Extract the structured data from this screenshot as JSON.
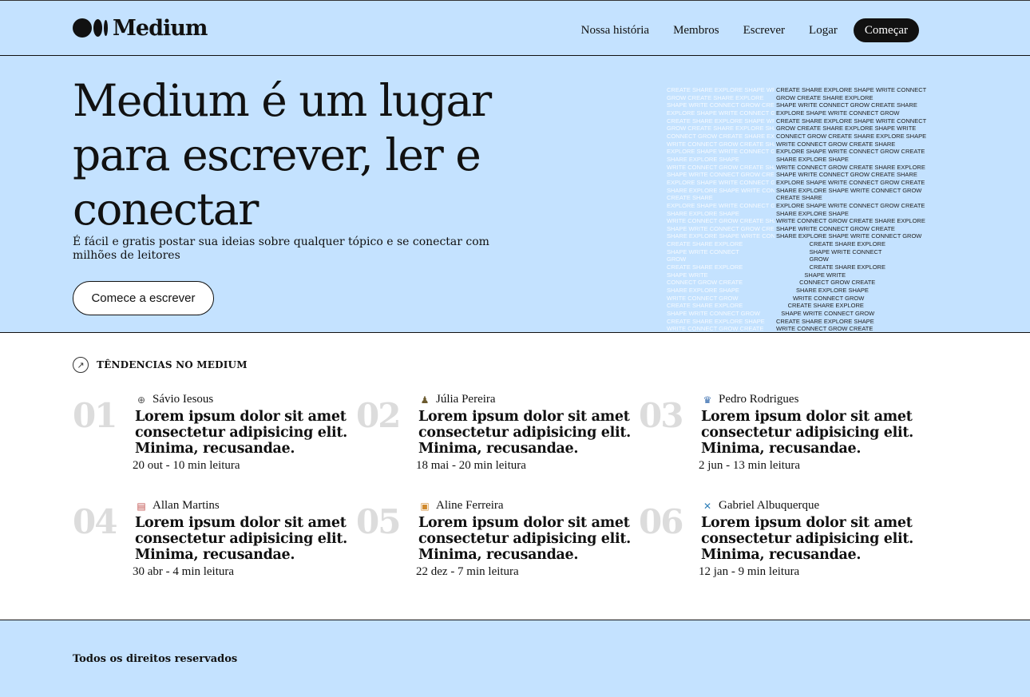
{
  "brand": {
    "name": "Medium"
  },
  "nav": [
    {
      "label": "Nossa história"
    },
    {
      "label": "Membros"
    },
    {
      "label": "Escrever"
    },
    {
      "label": "Logar"
    }
  ],
  "nav_cta": "Começar",
  "hero": {
    "title": "Medium é um lugar para escrever, ler e conectar",
    "subtitle": "É fácil e gratis postar sua ideias sobre qualquer tópico e se conectar com milhões de leitores",
    "button": "Comece a escrever"
  },
  "art": {
    "ghost_lines": [
      "CREATE SHARE EXPLORE SHAPE WRITE CONNECT",
      "GROW CREATE SHARE EXPLORE",
      "SHAPE WRITE CONNECT GROW CREATE SHARE",
      "EXPLORE SHAPE WRITE CONNECT GROW",
      "CREATE SHARE EXPLORE SHAPE WRITE CONNECT",
      "GROW CREATE SHARE EXPLORE SHAPE WRITE",
      "CONNECT GROW CREATE SHARE EXPLORE SHAPE",
      "WRITE CONNECT GROW CREATE SHARE",
      "EXPLORE SHAPE WRITE CONNECT GROW CREATE",
      "SHARE EXPLORE SHAPE",
      "WRITE CONNECT GROW CREATE SHARE EXPLORE",
      "SHAPE WRITE CONNECT GROW CREATE SHARE",
      "EXPLORE SHAPE WRITE CONNECT GROW CREATE",
      "SHARE EXPLORE SHAPE WRITE CONNECT GROW",
      "CREATE SHARE",
      "EXPLORE SHAPE WRITE CONNECT GROW CREATE",
      "SHARE EXPLORE SHAPE",
      "WRITE CONNECT GROW CREATE SHARE EXPLORE",
      "SHAPE WRITE CONNECT GROW CREATE",
      "SHARE EXPLORE SHAPE WRITE CONNECT GROW",
      "CREATE SHARE EXPLORE",
      "SHAPE WRITE CONNECT",
      "GROW",
      "CREATE SHARE EXPLORE",
      "SHAPE WRITE",
      "CONNECT GROW CREATE",
      "SHARE EXPLORE SHAPE",
      "WRITE CONNECT GROW",
      "CREATE SHARE EXPLORE",
      "SHAPE WRITE CONNECT GROW",
      "CREATE SHARE EXPLORE SHAPE",
      "WRITE CONNECT GROW CREATE"
    ],
    "dark_lines": [
      "CREATE SHARE EXPLORE SHAPE WRITE CONNECT",
      "GROW CREATE SHARE EXPLORE",
      "SHAPE WRITE CONNECT GROW CREATE SHARE",
      "EXPLORE SHAPE WRITE CONNECT GROW",
      "CREATE SHARE EXPLORE SHAPE WRITE CONNECT",
      "GROW CREATE SHARE EXPLORE SHAPE WRITE",
      "CONNECT GROW CREATE SHARE EXPLORE SHAPE",
      "WRITE CONNECT GROW CREATE SHARE",
      "EXPLORE SHAPE WRITE CONNECT GROW CREATE",
      "SHARE EXPLORE SHAPE",
      "WRITE CONNECT GROW CREATE SHARE EXPLORE",
      "SHAPE WRITE CONNECT GROW CREATE SHARE",
      "EXPLORE SHAPE WRITE CONNECT GROW CREATE",
      "SHARE EXPLORE SHAPE WRITE CONNECT GROW",
      "CREATE SHARE",
      "EXPLORE SHAPE WRITE CONNECT GROW CREATE",
      "SHARE EXPLORE SHAPE",
      "WRITE CONNECT GROW CREATE SHARE EXPLORE",
      "SHAPE WRITE CONNECT GROW CREATE",
      "SHARE EXPLORE SHAPE WRITE CONNECT GROW",
      "                    CREATE SHARE EXPLORE",
      "                    SHAPE WRITE CONNECT",
      "                    GROW",
      "                    CREATE SHARE EXPLORE",
      "                 SHAPE WRITE",
      "              CONNECT GROW CREATE",
      "            SHARE EXPLORE SHAPE",
      "          WRITE CONNECT GROW",
      "       CREATE SHARE EXPLORE",
      "   SHAPE WRITE CONNECT GROW",
      "CREATE SHARE EXPLORE SHAPE",
      "WRITE CONNECT GROW CREATE"
    ]
  },
  "trending": {
    "label": "TÊNDENCIAS NO MEDIUM",
    "items": [
      {
        "num": "01",
        "author": "Sávio Iesous",
        "avatar": "⊕",
        "avatar_color": "#555555",
        "title": "Lorem ipsum dolor sit amet consectetur adipisicing elit. Minima, recusandae.",
        "meta": "20 out - 10 min leitura"
      },
      {
        "num": "02",
        "author": "Júlia Pereira",
        "avatar": "♟",
        "avatar_color": "#6b5a2e",
        "title": "Lorem ipsum dolor sit amet consectetur adipisicing elit. Minima, recusandae.",
        "meta": "18 mai - 20 min leitura"
      },
      {
        "num": "03",
        "author": "Pedro Rodrigues",
        "avatar": "♛",
        "avatar_color": "#3a6fb0",
        "title": "Lorem ipsum dolor sit amet consectetur adipisicing elit. Minima, recusandae.",
        "meta": "2 jun - 13 min leitura"
      },
      {
        "num": "04",
        "author": "Allan Martins",
        "avatar": "▤",
        "avatar_color": "#c0504d",
        "title": "Lorem ipsum dolor sit amet consectetur adipisicing elit. Minima, recusandae.",
        "meta": "30 abr - 4 min leitura"
      },
      {
        "num": "05",
        "author": "Aline Ferreira",
        "avatar": "▣",
        "avatar_color": "#d08a2e",
        "title": "Lorem ipsum dolor sit amet consectetur adipisicing elit. Minima, recusandae.",
        "meta": "22 dez - 7 min leitura"
      },
      {
        "num": "06",
        "author": "Gabriel Albuquerque",
        "avatar": "✕",
        "avatar_color": "#2e7fb8",
        "title": "Lorem ipsum dolor sit amet consectetur adipisicing elit. Minima, recusandae.",
        "meta": "12 jan - 9 min leitura"
      }
    ]
  },
  "footer": {
    "text": "Todos os direitos reservados"
  },
  "colors": {
    "accent_bg": "#c4e2ff",
    "text": "#111111",
    "number": "#dcdcdc"
  }
}
